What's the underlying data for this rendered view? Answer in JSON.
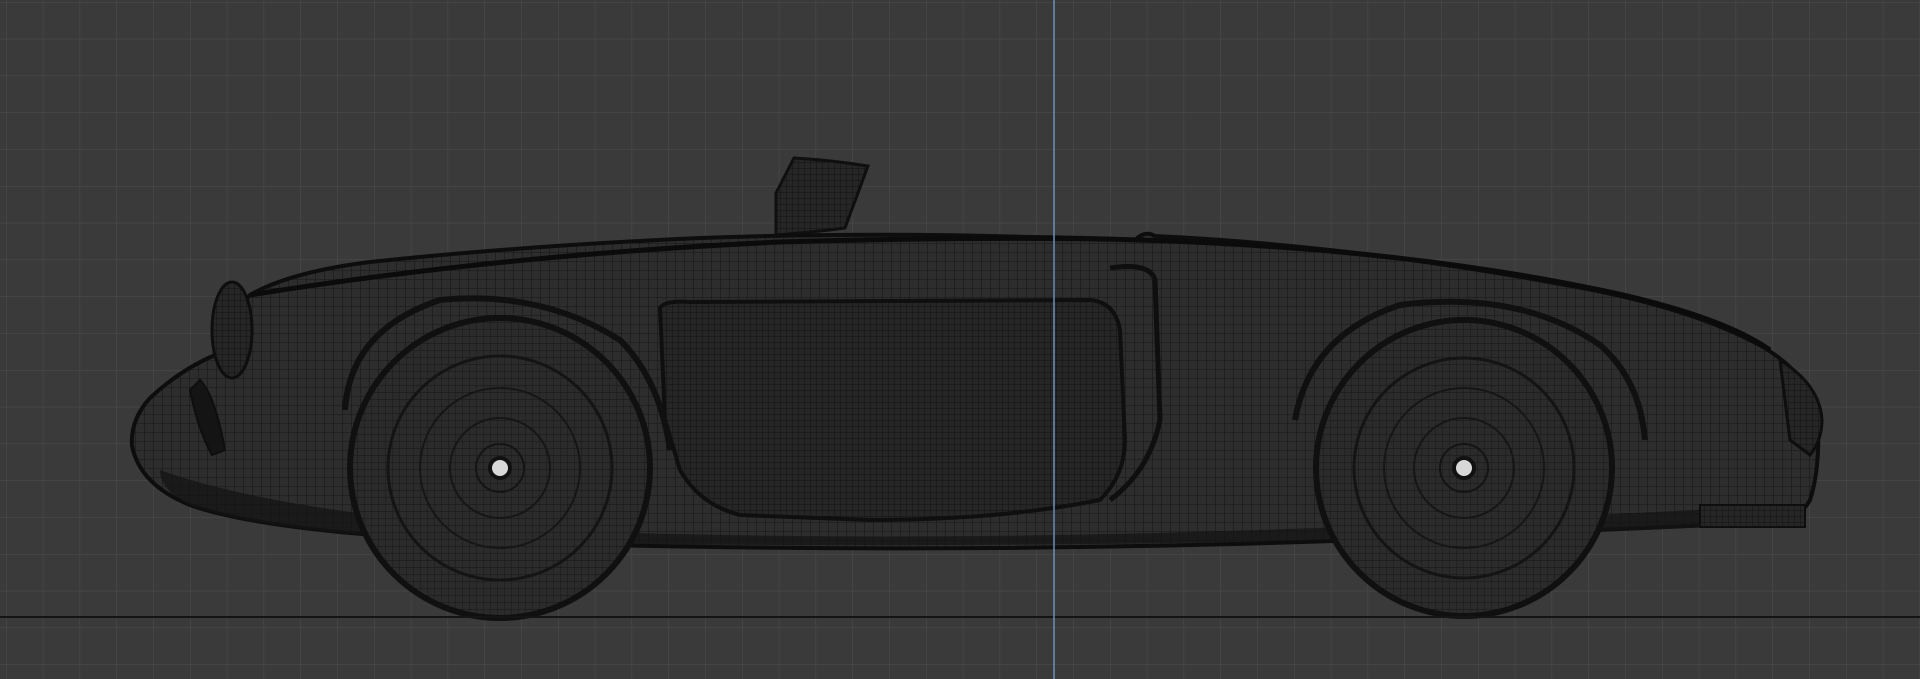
{
  "viewport": {
    "view": "side-orthographic",
    "display_mode": "wireframe",
    "background_color": "#3a3a3a",
    "grid_minor_color": "#4d4d4d",
    "grid_major_color": "#5a5a5a",
    "vertical_axis_color": "#6e8fb8",
    "ground_line_color": "#141414",
    "model": {
      "name": "roadster-car",
      "wire_color": "#1a1a1a",
      "dense_wire_color": "#121212",
      "wheel_count": 2
    }
  }
}
